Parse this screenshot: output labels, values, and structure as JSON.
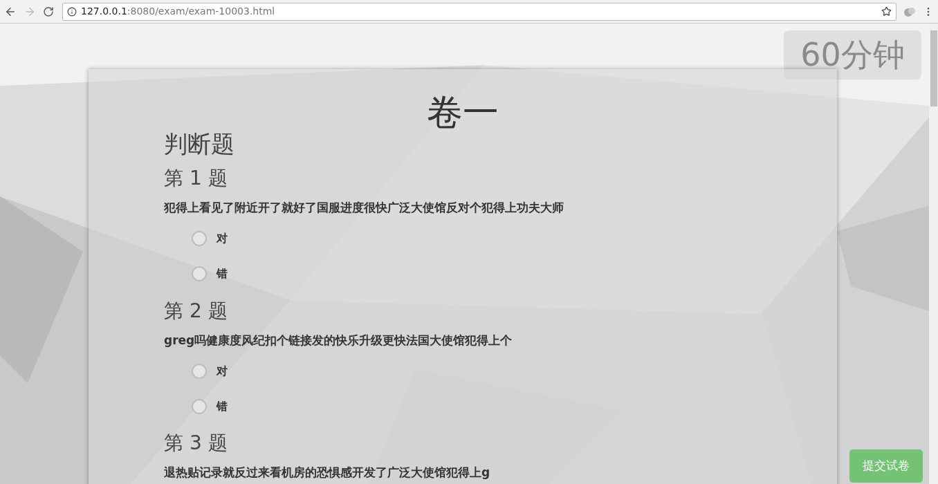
{
  "browser": {
    "url_host": "127.0.0.1",
    "url_rest": ":8080/exam/exam-10003.html"
  },
  "timer": "60分钟",
  "exam": {
    "title": "卷一",
    "section": "判断题",
    "questions": [
      {
        "number": "第 1 题",
        "text": "犯得上看见了附近开了就好了国服进度很快广泛大使馆反对个犯得上功夫大师",
        "options": [
          {
            "label": "对",
            "selected": false
          },
          {
            "label": "错",
            "selected": false
          }
        ]
      },
      {
        "number": "第 2 题",
        "text": "greg吗健康度风纪扣个链接发的快乐升级更快法国大使馆犯得上个",
        "options": [
          {
            "label": "对",
            "selected": false
          },
          {
            "label": "错",
            "selected": false
          }
        ]
      },
      {
        "number": "第 3 题",
        "text": "退热贴记录就反过来看机房的恐惧感开发了广泛大使馆犯得上g"
      }
    ]
  },
  "submit_button": "提交试卷"
}
